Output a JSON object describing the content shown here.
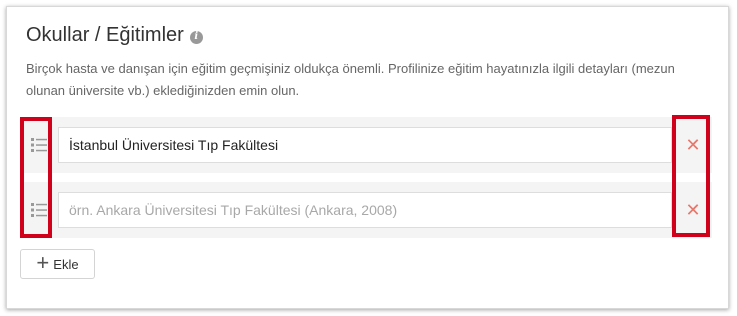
{
  "section": {
    "title": "Okullar / Eğitimler",
    "info_icon": "info-icon",
    "description": "Birçok hasta ve danışan için eğitim geçmişiniz oldukça önemli. Profilinize eğitim hayatınızla ilgili detayları (mezun olunan üniversite vb.) eklediğinizden emin olun."
  },
  "education_rows": [
    {
      "value": "İstanbul Üniversitesi Tıp Fakültesi",
      "placeholder": "örn. Ankara Üniversitesi Tıp Fakültesi (Ankara, 2008)",
      "handle_icon": "drag-handle-icon",
      "remove_icon": "remove-icon",
      "remove_glyph": "✕"
    },
    {
      "value": "",
      "placeholder": "örn. Ankara Üniversitesi Tıp Fakültesi (Ankara, 2008)",
      "handle_icon": "drag-handle-icon",
      "remove_icon": "remove-icon",
      "remove_glyph": "✕"
    }
  ],
  "add_button": {
    "label": "Ekle",
    "icon": "plus-icon",
    "glyph": "+"
  },
  "colors": {
    "remove_icon": "#e7786b",
    "highlight_border": "#d0021b",
    "row_background": "#f4f4f4"
  }
}
